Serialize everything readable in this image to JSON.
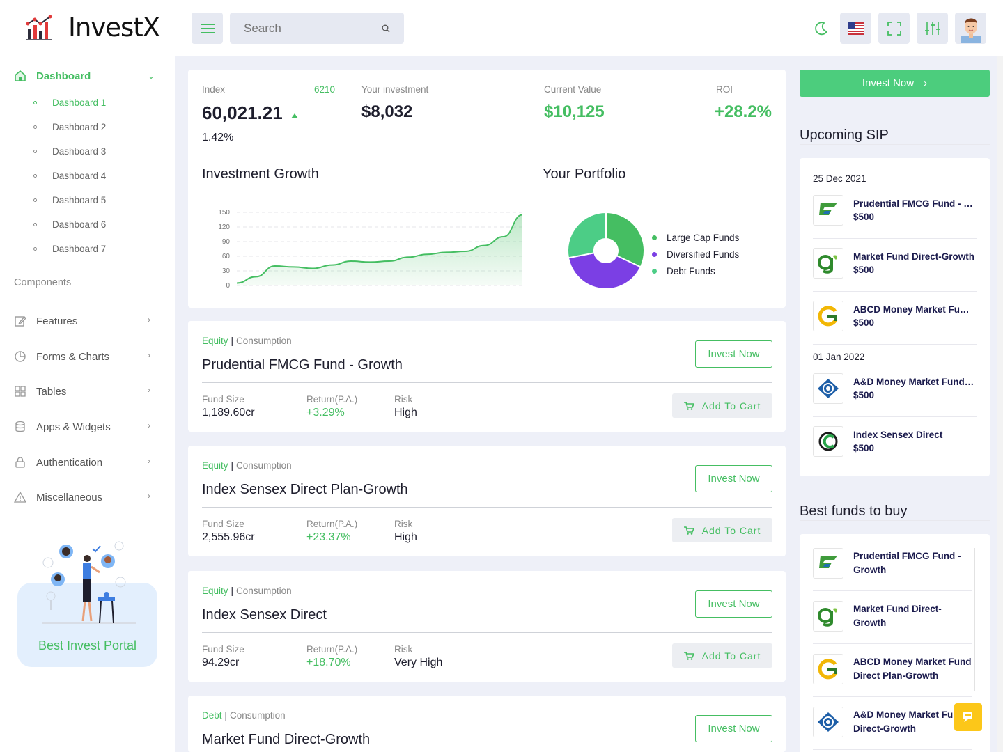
{
  "app": {
    "name": "InvestX"
  },
  "search": {
    "placeholder": "Search"
  },
  "sidebar": {
    "dashboard_label": "Dashboard",
    "sub_items": [
      "Dashboard 1",
      "Dashboard 2",
      "Dashboard 3",
      "Dashboard 4",
      "Dashboard 5",
      "Dashboard 6",
      "Dashboard 7"
    ],
    "section_label": "Components",
    "items": [
      {
        "label": "Features",
        "icon": "edit-icon"
      },
      {
        "label": "Forms & Charts",
        "icon": "pie-chart-icon"
      },
      {
        "label": "Tables",
        "icon": "grid-icon"
      },
      {
        "label": "Apps & Widgets",
        "icon": "database-icon"
      },
      {
        "label": "Authentication",
        "icon": "lock-icon"
      },
      {
        "label": "Miscellaneous",
        "icon": "warning-icon"
      }
    ],
    "promo_text": "Best Invest Portal"
  },
  "stats": {
    "index_label": "Index",
    "index_count": "6210",
    "index_value": "60,021.21",
    "index_change": "1.42%",
    "investment_label": "Your investment",
    "investment_value": "$8,032",
    "current_label": "Current Value",
    "current_value": "$10,125",
    "roi_label": "ROI",
    "roi_value": "+28.2%"
  },
  "growth": {
    "title": "Investment Growth"
  },
  "portfolio": {
    "title": "Your Portfolio"
  },
  "chart_data": [
    {
      "type": "area",
      "y_ticks": [
        0,
        30,
        60,
        90,
        120,
        150
      ],
      "ylim": [
        0,
        150
      ],
      "values": [
        5,
        18,
        40,
        38,
        35,
        42,
        50,
        48,
        50,
        58,
        64,
        68,
        70,
        82,
        100,
        145
      ],
      "color": "#45be62"
    },
    {
      "type": "pie",
      "donut": true,
      "categories": [
        "Large Cap Funds",
        "Diversified Funds",
        "Debt Funds"
      ],
      "values": [
        32,
        40,
        28
      ],
      "colors": [
        "#45be62",
        "#7b3fe4",
        "#4ccd86"
      ]
    }
  ],
  "funds": [
    {
      "type": "Equity",
      "category": "Consumption",
      "name": "Prudential FMCG Fund - Growth",
      "size_label": "Fund Size",
      "size": "1,189.60cr",
      "return_label": "Return(P.A.)",
      "return": "+3.29%",
      "risk_label": "Risk",
      "risk": "High"
    },
    {
      "type": "Equity",
      "category": "Consumption",
      "name": "Index Sensex Direct Plan-Growth",
      "size_label": "Fund Size",
      "size": "2,555.96cr",
      "return_label": "Return(P.A.)",
      "return": "+23.37%",
      "risk_label": "Risk",
      "risk": "High"
    },
    {
      "type": "Equity",
      "category": "Consumption",
      "name": "Index Sensex Direct",
      "size_label": "Fund Size",
      "size": "94.29cr",
      "return_label": "Return(P.A.)",
      "return": "+18.70%",
      "risk_label": "Risk",
      "risk": "Very High"
    },
    {
      "type": "Debt",
      "category": "Consumption",
      "name": "Market Fund Direct-Growth"
    }
  ],
  "buttons": {
    "invest_now": "Invest Now",
    "add_to_cart": "Add To Cart"
  },
  "sip": {
    "title": "Upcoming SIP",
    "groups": [
      {
        "date": "25 Dec 2021",
        "items": [
          {
            "name": "Prudential FMCG Fund - Growth",
            "amount": "$500"
          },
          {
            "name": "Market Fund Direct-Growth",
            "amount": "$500"
          },
          {
            "name": "ABCD Money Market Fund Direct",
            "amount": "$500"
          }
        ]
      },
      {
        "date": "01 Jan 2022",
        "items": [
          {
            "name": "A&D Money Market Fund Direct",
            "amount": "$500"
          },
          {
            "name": "Index Sensex Direct",
            "amount": "$500"
          }
        ]
      }
    ]
  },
  "best": {
    "title": "Best funds to buy",
    "items": [
      {
        "line1": "Prudential FMCG Fund -",
        "line2": "Growth"
      },
      {
        "line1": "Market Fund Direct-",
        "line2": "Growth"
      },
      {
        "line1": "ABCD Money Market Fund",
        "line2": "Direct Plan-Growth"
      },
      {
        "line1": "A&D Money Market Fund",
        "line2": "Direct-Growth"
      }
    ]
  }
}
